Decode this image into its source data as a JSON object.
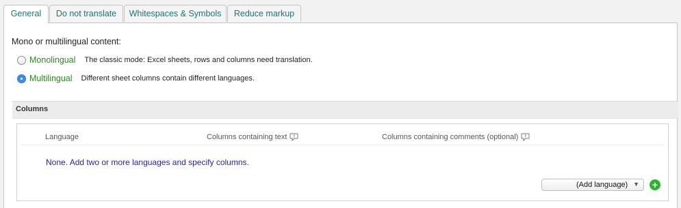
{
  "tabs": [
    {
      "label": "General"
    },
    {
      "label": "Do not translate"
    },
    {
      "label": "Whitespaces & Symbols"
    },
    {
      "label": "Reduce markup"
    }
  ],
  "content_mode": {
    "heading": "Mono or multilingual content:",
    "options": [
      {
        "label": "Monolingual",
        "description": "The classic mode: Excel sheets, rows and columns need translation.",
        "selected": false
      },
      {
        "label": "Multilingual",
        "description": "Different sheet columns contain different languages.",
        "selected": true
      }
    ]
  },
  "columns": {
    "section_title": "Columns",
    "headers": {
      "language": "Language",
      "text_columns": "Columns containing text",
      "comment_columns": "Columns containing comments (optional)"
    },
    "empty_message": "None. Add two or more languages and specify columns.",
    "add_language_select": {
      "value": "(Add language)"
    },
    "add_button_icon": "plus-circle-icon"
  },
  "colors": {
    "tab_text": "#0c7b7b",
    "option_label": "#2a8a1f",
    "empty_message": "#2323b8",
    "radio_selected": "#3b8cf0",
    "add_button": "#2cb52c"
  }
}
